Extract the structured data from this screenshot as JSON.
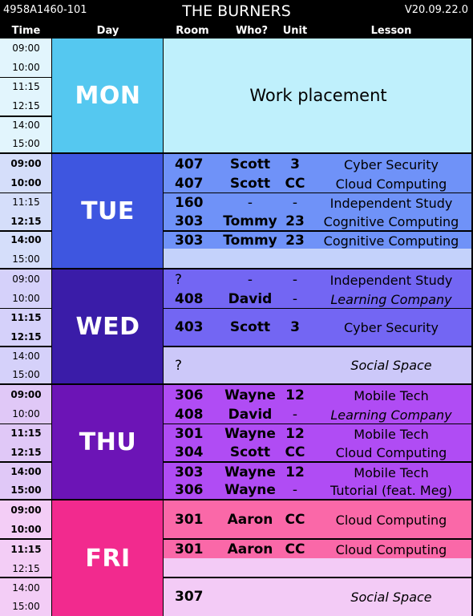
{
  "header": {
    "code": "4958A1460-101",
    "title": "THE BURNERS",
    "version": "V20.09.22.0"
  },
  "columns": {
    "time": "Time",
    "day": "Day",
    "room": "Room",
    "who": "Who?",
    "unit": "Unit",
    "lesson": "Lesson"
  },
  "times": [
    "09:00",
    "10:00",
    "11:15",
    "12:15",
    "14:00",
    "15:00"
  ],
  "days": {
    "mon": {
      "label": "MON",
      "work_placement": "Work placement"
    },
    "tue": {
      "label": "TUE",
      "rows": [
        {
          "room": "407",
          "who": "Scott",
          "unit": "3",
          "lesson": "Cyber Security"
        },
        {
          "room": "407",
          "who": "Scott",
          "unit": "CC",
          "lesson": "Cloud Computing"
        },
        {
          "room": "160",
          "who": "-",
          "unit": "-",
          "lesson": "Independent Study"
        },
        {
          "room": "303",
          "who": "Tommy",
          "unit": "23",
          "lesson": "Cognitive Computing"
        },
        {
          "room": "303",
          "who": "Tommy",
          "unit": "23",
          "lesson": "Cognitive Computing"
        }
      ]
    },
    "wed": {
      "label": "WED",
      "rows": [
        {
          "room": "?",
          "who": "-",
          "unit": "-",
          "lesson": "Independent Study"
        },
        {
          "room": "408",
          "who": "David",
          "unit": "-",
          "lesson": "Learning Company"
        },
        {
          "room": "403",
          "who": "Scott",
          "unit": "3",
          "lesson": "Cyber Security"
        },
        {
          "room": "?",
          "who": "",
          "unit": "",
          "lesson": "Social Space"
        }
      ]
    },
    "thu": {
      "label": "THU",
      "rows": [
        {
          "room": "306",
          "who": "Wayne",
          "unit": "12",
          "lesson": "Mobile Tech"
        },
        {
          "room": "408",
          "who": "David",
          "unit": "-",
          "lesson": "Learning Company"
        },
        {
          "room": "301",
          "who": "Wayne",
          "unit": "12",
          "lesson": "Mobile Tech"
        },
        {
          "room": "304",
          "who": "Scott",
          "unit": "CC",
          "lesson": "Cloud Computing"
        },
        {
          "room": "303",
          "who": "Wayne",
          "unit": "12",
          "lesson": "Mobile Tech"
        },
        {
          "room": "306",
          "who": "Wayne",
          "unit": "-",
          "lesson": "Tutorial (feat. Meg)"
        }
      ]
    },
    "fri": {
      "label": "FRI",
      "rows": [
        {
          "room": "301",
          "who": "Aaron",
          "unit": "CC",
          "lesson": "Cloud Computing"
        },
        {
          "room": "301",
          "who": "Aaron",
          "unit": "CC",
          "lesson": "Cloud Computing"
        },
        {
          "room": "307",
          "who": "",
          "unit": "",
          "lesson": "Social Space"
        }
      ]
    }
  },
  "colors": {
    "mon_day": "#55c8f0",
    "mon_light": "#bff0fc",
    "mon_time": "#e2f5fd",
    "tue_day": "#3e56e0",
    "tue_main": "#6f92f8",
    "tue_light": "#c4d2fb",
    "tue_time": "#d5defa",
    "wed_day": "#3a1ca8",
    "wed_main": "#7366f3",
    "wed_light": "#ccc8f9",
    "wed_time": "#d5d1fa",
    "thu_day": "#6c14b6",
    "thu_main": "#b04cf4",
    "thu_time": "#e0c8f7",
    "fri_day": "#f22a8e",
    "fri_main": "#fa68a8",
    "fri_light": "#f3cbf6",
    "fri_time": "#f3cdf6"
  }
}
